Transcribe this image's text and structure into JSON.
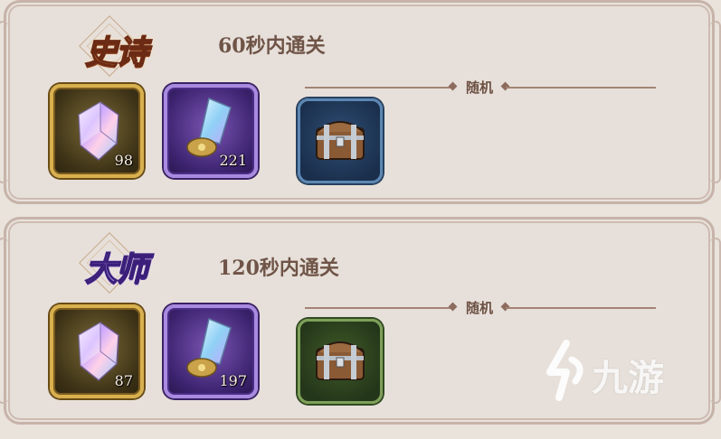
{
  "tiers": [
    {
      "badge": "史诗",
      "condition": "60秒内通关",
      "random_label": "随机",
      "rewards": [
        {
          "icon": "rainbow-crystal-icon",
          "quantity": "98"
        },
        {
          "icon": "crystal-shard-icon",
          "quantity": "221"
        },
        {
          "icon": "treasure-chest-icon",
          "quantity": ""
        }
      ]
    },
    {
      "badge": "大师",
      "condition": "120秒内通关",
      "random_label": "随机",
      "rewards": [
        {
          "icon": "rainbow-crystal-icon",
          "quantity": "87"
        },
        {
          "icon": "crystal-shard-icon",
          "quantity": "197"
        },
        {
          "icon": "treasure-chest-icon",
          "quantity": ""
        }
      ]
    }
  ],
  "watermark": "九游",
  "colors": {
    "panel_bg": "#e7e0da",
    "panel_border": "#c7b3a9",
    "text_brown": "#6f5447",
    "epic_orange": "#f3a64a",
    "master_purple": "#c7b5ff"
  }
}
